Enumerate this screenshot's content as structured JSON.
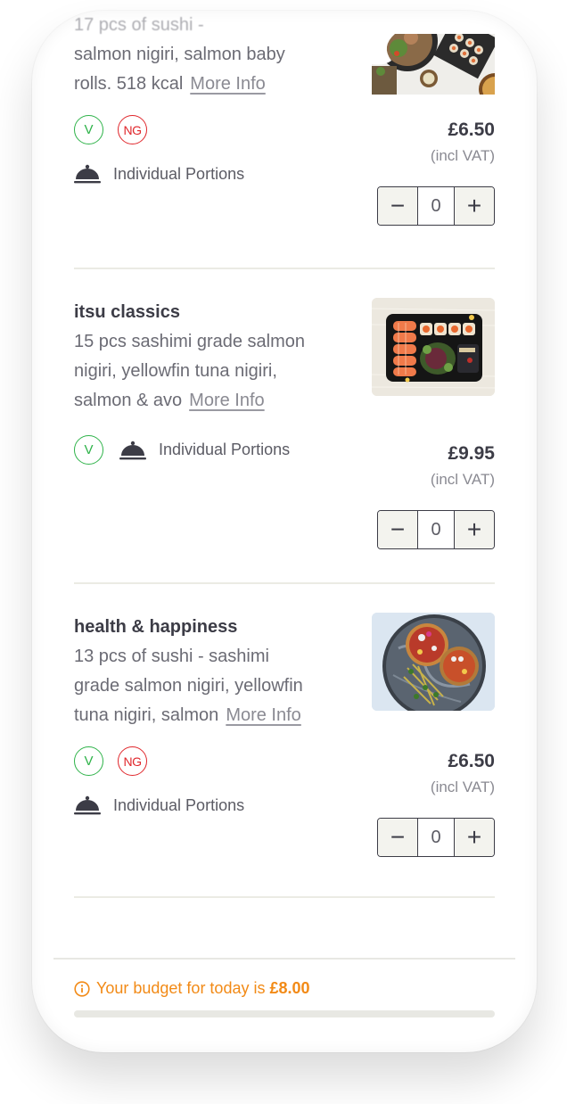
{
  "menu": {
    "items": [
      {
        "title": "",
        "description_lines": [
          "17 pcs of sushi -",
          "salmon nigiri, salmon baby",
          "rolls. 518 kcal"
        ],
        "more_info": "More Info",
        "badges": [
          "V",
          "NG"
        ],
        "portion": "Individual Portions",
        "price": "£6.50",
        "vat_note": "(incl VAT)",
        "quantity": "0",
        "image": "sushi-platter-photo"
      },
      {
        "title": "itsu classics",
        "description_lines": [
          "15 pcs sashimi grade salmon",
          "nigiri, yellowfin tuna nigiri,",
          "salmon & avo"
        ],
        "more_info": "More Info",
        "badges": [
          "V"
        ],
        "portion": "Individual Portions",
        "price": "£9.95",
        "vat_note": "(incl VAT)",
        "quantity": "0",
        "image": "sushi-box-photo"
      },
      {
        "title": "health & happiness",
        "description_lines": [
          "13 pcs of sushi - sashimi",
          "grade salmon nigiri, yellowfin",
          "tuna nigiri, salmon"
        ],
        "more_info": "More Info",
        "badges": [
          "V",
          "NG"
        ],
        "portion": "Individual Portions",
        "price": "£6.50",
        "vat_note": "(incl VAT)",
        "quantity": "0",
        "image": "tostada-plate-photo"
      }
    ]
  },
  "stepper": {
    "minus": "−",
    "plus": "+"
  },
  "budget": {
    "text": "Your budget for today is",
    "amount": "£8.00",
    "progress_percent": 0,
    "accent_color": "#f28a16"
  },
  "colors": {
    "vegetarian_badge": "#2fb34a",
    "no_gluten_badge": "#e0262b",
    "text_dark": "#3c3c46"
  }
}
